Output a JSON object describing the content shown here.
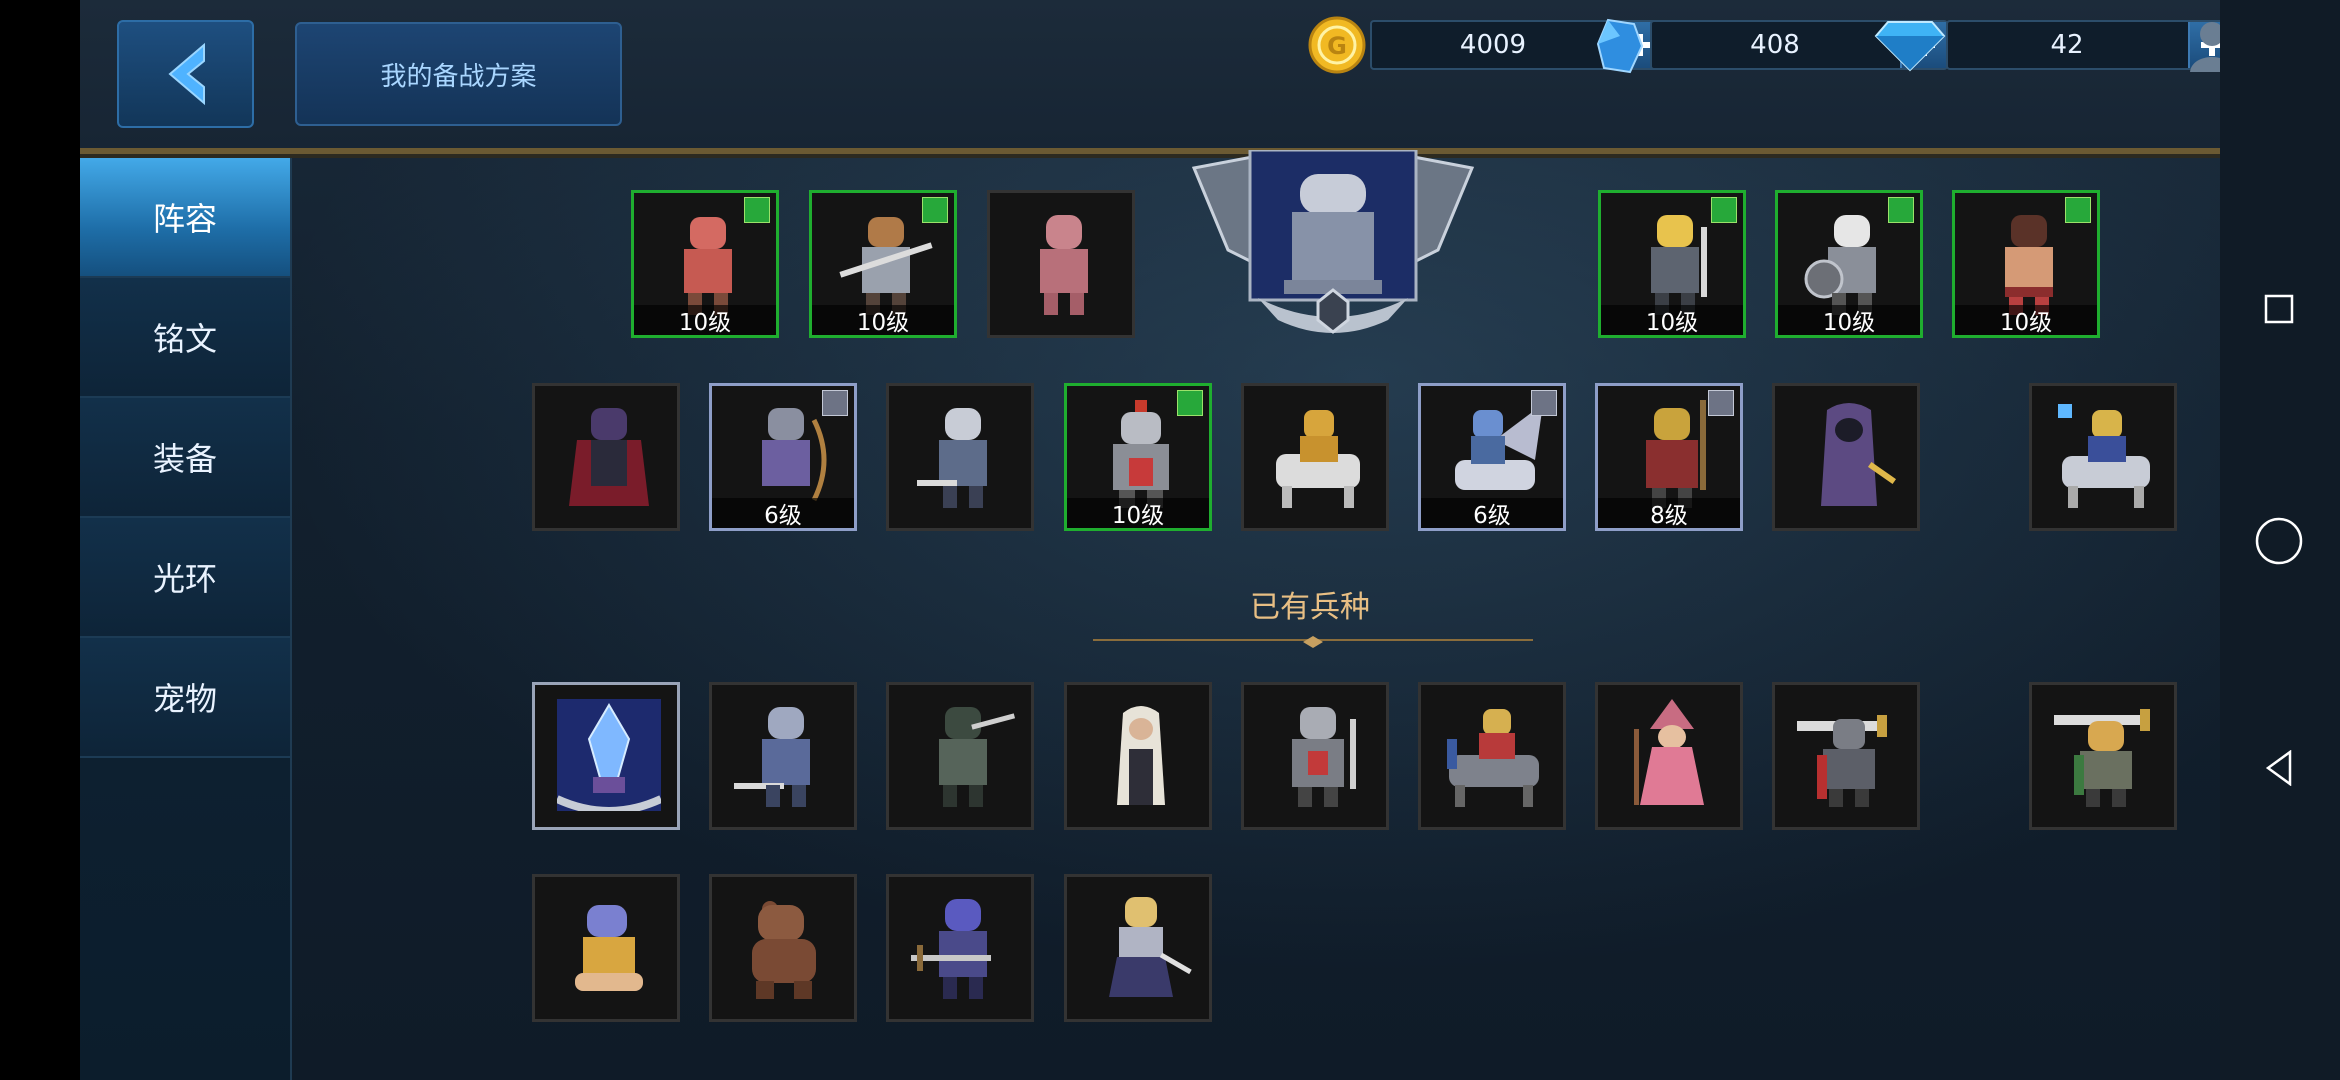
{
  "header": {
    "plan_label": "我的备战方案",
    "resources": [
      {
        "name": "gold",
        "value": "4009",
        "icon": "gold-coin-icon",
        "color": "#f1b923"
      },
      {
        "name": "crystal",
        "value": "408",
        "icon": "blue-crystal-icon",
        "color": "#3ea6f0"
      },
      {
        "name": "diamond",
        "value": "42",
        "icon": "diamond-icon",
        "color": "#3fb3f5"
      }
    ]
  },
  "sidebar": {
    "items": [
      {
        "label": "阵容",
        "active": true
      },
      {
        "label": "铭文"
      },
      {
        "label": "装备"
      },
      {
        "label": "光环"
      },
      {
        "label": "宠物"
      }
    ]
  },
  "lineup": {
    "row1": [
      {
        "level": "10级",
        "selected": true
      },
      {
        "level": "10级",
        "selected": true
      },
      {
        "level": "",
        "selected": false
      },
      {
        "level": "10级",
        "selected": true
      },
      {
        "level": "10级",
        "selected": true
      },
      {
        "level": "10级",
        "selected": true
      }
    ],
    "row2": [
      {
        "level": ""
      },
      {
        "level": "6级"
      },
      {
        "level": ""
      },
      {
        "level": "10级"
      },
      {
        "level": ""
      },
      {
        "level": "6级"
      },
      {
        "level": "8级"
      },
      {
        "level": ""
      },
      {
        "level": ""
      }
    ]
  },
  "owned": {
    "title": "已有兵种"
  },
  "colors": {
    "accent_gold": "#e8bf84",
    "active_tab": "#43a9e8",
    "level_badge": "#27a83a"
  }
}
